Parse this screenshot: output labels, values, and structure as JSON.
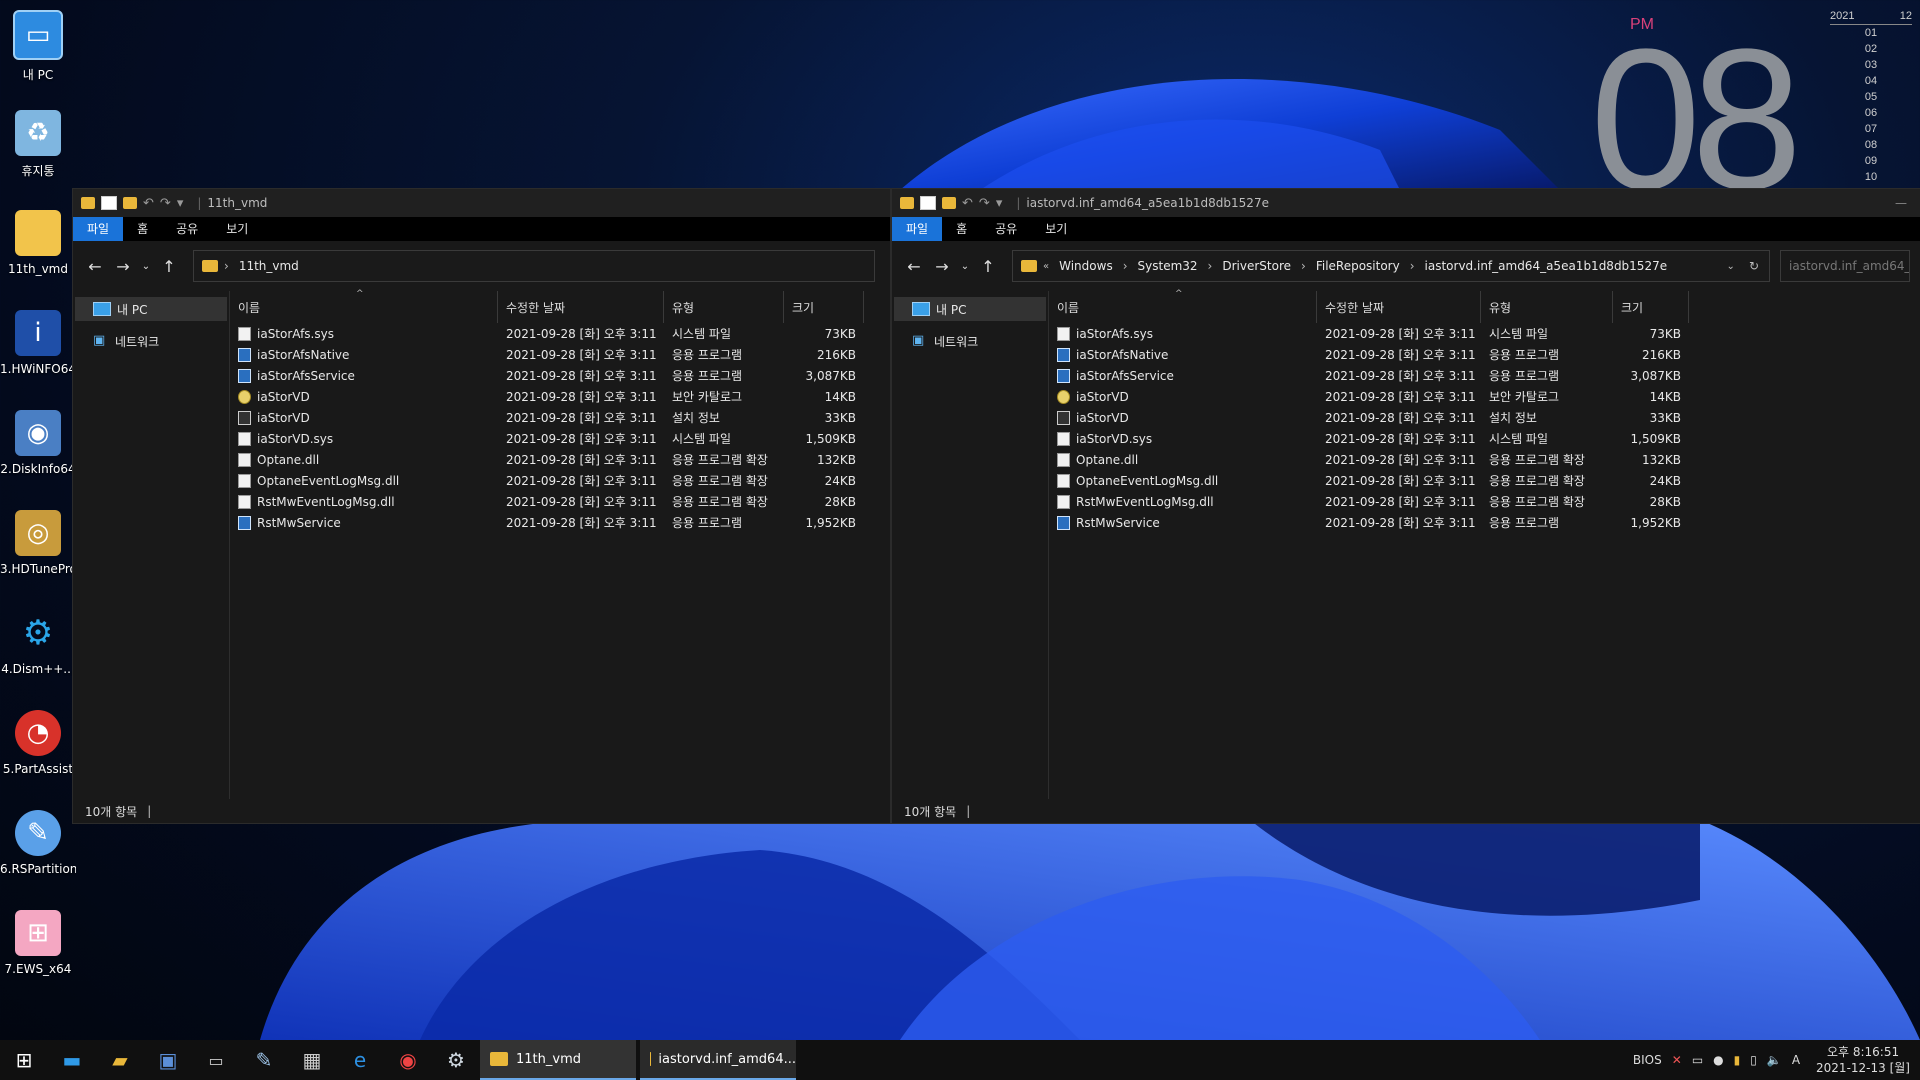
{
  "desktop": {
    "icons": [
      {
        "label": "내 PC",
        "icon": "monitor-icon"
      },
      {
        "label": "휴지통",
        "icon": "recycle-bin-icon"
      },
      {
        "label": "11th_vmd",
        "icon": "folder-icon"
      },
      {
        "label": "1.HWiNFO64",
        "icon": "hwinfo-icon"
      },
      {
        "label": "2.DiskInfo64",
        "icon": "diskinfo-icon"
      },
      {
        "label": "3.HDTunePro",
        "icon": "hdtune-icon"
      },
      {
        "label": "4.Dism++...",
        "icon": "gears-icon"
      },
      {
        "label": "5.PartAssist",
        "icon": "partassist-icon"
      },
      {
        "label": "6.RSPartition",
        "icon": "rspartition-icon"
      },
      {
        "label": "7.EWS_x64",
        "icon": "windows-logo-icon"
      }
    ]
  },
  "clock_widget": {
    "ampm": "PM",
    "hour": "08",
    "calendar_year": "2021",
    "calendar_month": "12",
    "days": [
      "01",
      "02",
      "03",
      "04",
      "05",
      "06",
      "07",
      "08",
      "09",
      "10"
    ]
  },
  "columns": {
    "name": "이름",
    "modified": "수정한 날짜",
    "type": "유형",
    "size": "크기"
  },
  "ribbon_tabs": {
    "file": "파일",
    "home": "홈",
    "share": "공유",
    "view": "보기"
  },
  "nav_pane": {
    "this_pc": "내 PC",
    "network": "네트워크"
  },
  "files": [
    {
      "name": "iaStorAfs.sys",
      "modified": "2021-09-28 [화] 오후 3:11",
      "type": "시스템 파일",
      "size": "73KB",
      "icon": "sys"
    },
    {
      "name": "iaStorAfsNative",
      "modified": "2021-09-28 [화] 오후 3:11",
      "type": "응용 프로그램",
      "size": "216KB",
      "icon": "app"
    },
    {
      "name": "iaStorAfsService",
      "modified": "2021-09-28 [화] 오후 3:11",
      "type": "응용 프로그램",
      "size": "3,087KB",
      "icon": "app"
    },
    {
      "name": "iaStorVD",
      "modified": "2021-09-28 [화] 오후 3:11",
      "type": "보안 카탈로그",
      "size": "14KB",
      "icon": "cat"
    },
    {
      "name": "iaStorVD",
      "modified": "2021-09-28 [화] 오후 3:11",
      "type": "설치 정보",
      "size": "33KB",
      "icon": "inf"
    },
    {
      "name": "iaStorVD.sys",
      "modified": "2021-09-28 [화] 오후 3:11",
      "type": "시스템 파일",
      "size": "1,509KB",
      "icon": "sys"
    },
    {
      "name": "Optane.dll",
      "modified": "2021-09-28 [화] 오후 3:11",
      "type": "응용 프로그램 확장",
      "size": "132KB",
      "icon": "dll"
    },
    {
      "name": "OptaneEventLogMsg.dll",
      "modified": "2021-09-28 [화] 오후 3:11",
      "type": "응용 프로그램 확장",
      "size": "24KB",
      "icon": "dll"
    },
    {
      "name": "RstMwEventLogMsg.dll",
      "modified": "2021-09-28 [화] 오후 3:11",
      "type": "응용 프로그램 확장",
      "size": "28KB",
      "icon": "dll"
    },
    {
      "name": "RstMwService",
      "modified": "2021-09-28 [화] 오후 3:11",
      "type": "응용 프로그램",
      "size": "1,952KB",
      "icon": "app"
    }
  ],
  "window_left": {
    "title": "11th_vmd",
    "breadcrumb": [
      "11th_vmd"
    ],
    "status": "10개 항목"
  },
  "window_right": {
    "title": "iastorvd.inf_amd64_a5ea1b1d8db1527e",
    "breadcrumb": [
      "Windows",
      "System32",
      "DriverStore",
      "FileRepository",
      "iastorvd.inf_amd64_a5ea1b1d8db1527e"
    ],
    "search_placeholder": "iastorvd.inf_amd64_...",
    "status": "10개 항목"
  },
  "taskbar": {
    "tasks": [
      "11th_vmd",
      "iastorvd.inf_amd64..."
    ],
    "tray_bios": "BIOS",
    "tray_ime": "A",
    "time": "오후 8:16:51",
    "date": "2021-12-13 [월]"
  }
}
